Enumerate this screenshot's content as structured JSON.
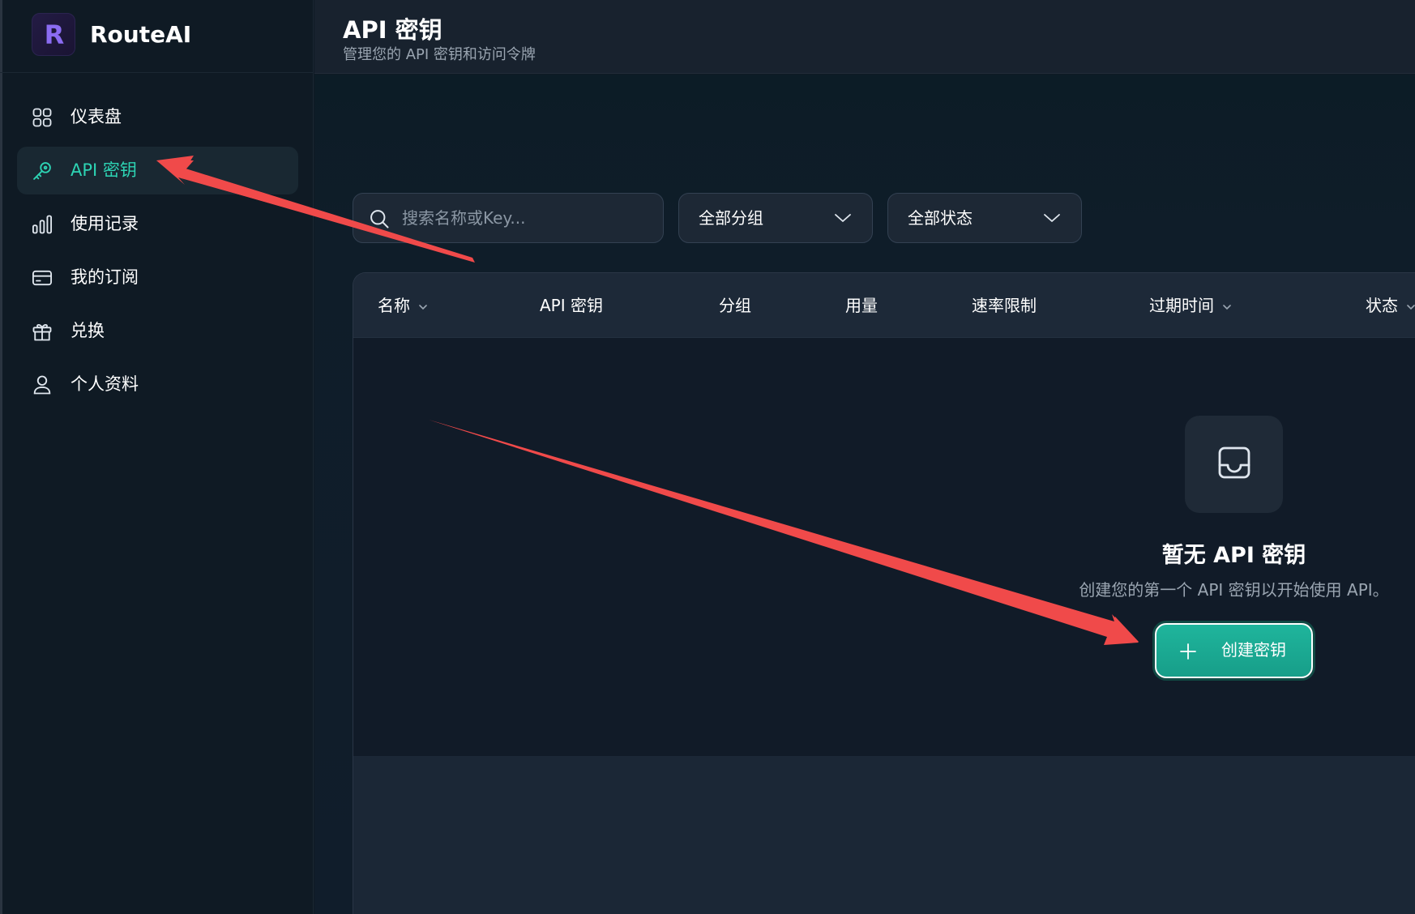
{
  "app": {
    "logo_letter": "R",
    "name": "RouteAI"
  },
  "sidebar": {
    "items": [
      {
        "label": "仪表盘",
        "icon": "grid-icon",
        "active": false
      },
      {
        "label": "API 密钥",
        "icon": "key-icon",
        "active": true
      },
      {
        "label": "使用记录",
        "icon": "bar-chart-icon",
        "active": false
      },
      {
        "label": "我的订阅",
        "icon": "credit-card-icon",
        "active": false
      },
      {
        "label": "兑换",
        "icon": "gift-icon",
        "active": false
      },
      {
        "label": "个人资料",
        "icon": "user-icon",
        "active": false
      }
    ]
  },
  "header": {
    "title": "API 密钥",
    "subtitle": "管理您的 API 密钥和访问令牌"
  },
  "filters": {
    "search_placeholder": "搜索名称或Key...",
    "search_value": "",
    "group_select": "全部分组",
    "status_select": "全部状态"
  },
  "table": {
    "columns": [
      "名称",
      "API 密钥",
      "分组",
      "用量",
      "速率限制",
      "过期时间",
      "状态"
    ],
    "sortable": [
      true,
      false,
      false,
      false,
      false,
      true,
      true
    ],
    "rows": []
  },
  "empty_state": {
    "icon": "inbox-icon",
    "title": "暂无 API 密钥",
    "description": "创建您的第一个 API 密钥以开始使用 API。",
    "button_label": "创建密钥"
  },
  "colors": {
    "accent": "#2dd4b4",
    "button": "#1aa893",
    "annotation": "#f04a4a",
    "brand_purple": "#8b6cf2"
  }
}
